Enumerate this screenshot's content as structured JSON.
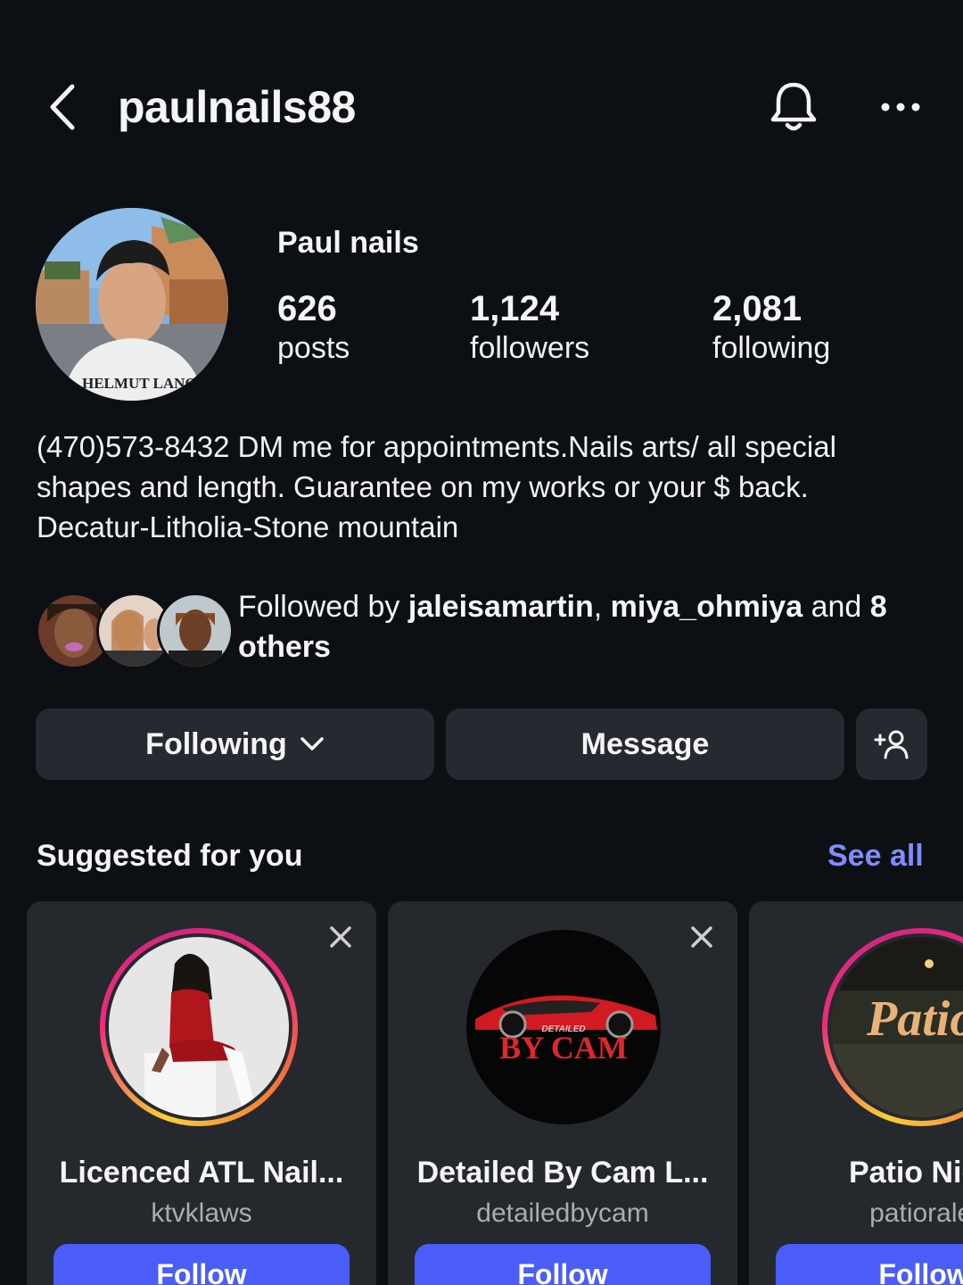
{
  "header": {
    "username": "paulnails88",
    "back_icon": "chevron-left-icon",
    "bell_icon": "bell-icon",
    "more_icon": "more-horizontal-icon"
  },
  "profile": {
    "display_name": "Paul nails",
    "avatar_shirt_text": "HELMUT LANG",
    "stats": [
      {
        "value": "626",
        "label": "posts"
      },
      {
        "value": "1,124",
        "label": "followers"
      },
      {
        "value": "2,081",
        "label": "following"
      }
    ],
    "bio": "(470)573-8432 DM me for appointments.Nails arts/ all special shapes and length. Guarantee on my works or your $ back. Decatur-Litholia-Stone mountain"
  },
  "followed_by": {
    "prefix": "Followed by ",
    "user1": "jaleisamartin",
    "sep": ", ",
    "user2": "miya_ohmiya",
    "and": " and ",
    "others": "8 others"
  },
  "actions": {
    "following_label": "Following",
    "message_label": "Message",
    "add_user_icon": "add-user-icon"
  },
  "suggested": {
    "title": "Suggested for you",
    "see_all": "See all",
    "cards": [
      {
        "name": "Licenced ATL Nail...",
        "handle": "ktvklaws",
        "follow": "Follow"
      },
      {
        "name": "Detailed By Cam L...",
        "handle": "detailedbycam",
        "follow": "Follow",
        "logo_small": "DETAILED",
        "logo_big": "BY CAM"
      },
      {
        "name": "Patio Nigh",
        "handle": "patioralei",
        "follow": "Follow",
        "logo_text": "Patio"
      }
    ]
  },
  "colors": {
    "background": "#0c1014",
    "button_bg": "#262a30",
    "card_bg": "#25292e",
    "accent_link": "#7f8cff",
    "follow_blue": "#4a5df9"
  }
}
